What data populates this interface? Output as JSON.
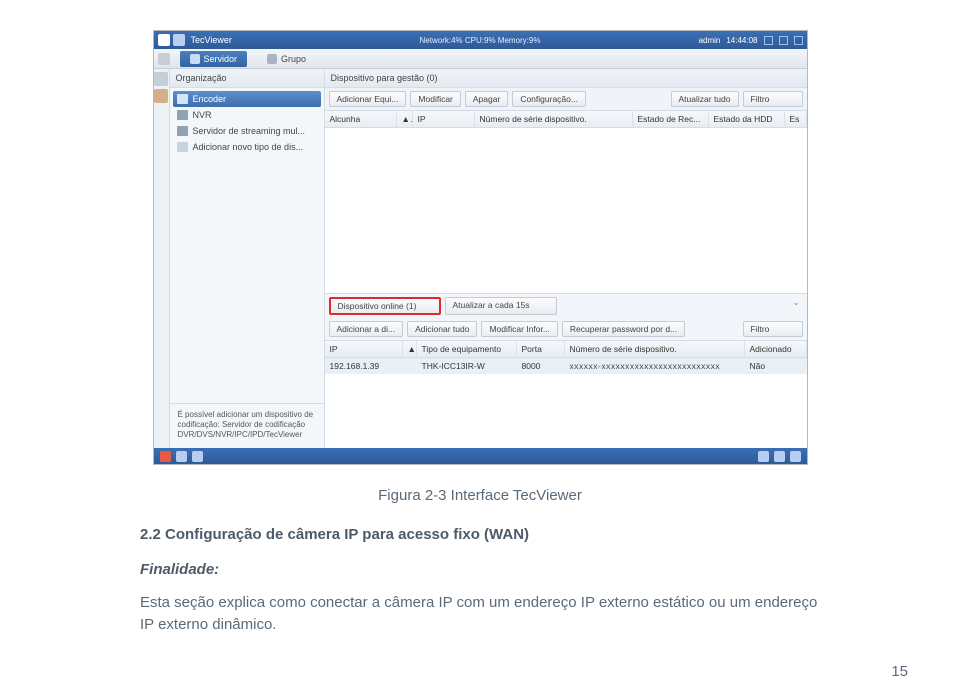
{
  "titlebar": {
    "app_name": "TecViewer",
    "network_status": "Network:4% CPU:9% Memory:9%",
    "user": "admin",
    "time": "14:44:08"
  },
  "topbar": {
    "tab_server": "Servidor",
    "tab_group": "Grupo"
  },
  "sidebar": {
    "title": "Organização",
    "items": [
      {
        "label": "Encoder"
      },
      {
        "label": "NVR"
      },
      {
        "label": "Servidor de streaming mul..."
      },
      {
        "label": "Adicionar novo tipo de dis..."
      }
    ],
    "note": "É possível adicionar um dispositivo de codificação: Servidor de codificação DVR/DVS/NVR/IPC/IPD/TecViewer"
  },
  "upper": {
    "title": "Dispositivo para gestão (0)",
    "buttons": {
      "add": "Adicionar Equi...",
      "modify": "Modificar",
      "delete": "Apagar",
      "config": "Configuração...",
      "refresh": "Atualizar tudo",
      "filter": "Filtro"
    },
    "columns": {
      "alias": "Alcunha",
      "sort": "▲",
      "ip": "IP",
      "serial": "Número de série dispositivo.",
      "recstate": "Estado de Rec...",
      "hdd": "Estado da HDD",
      "es": "Es"
    }
  },
  "lower": {
    "tabs": {
      "online": "Dispositivo online (1)",
      "refresh15": "Atualizar a cada 15s"
    },
    "buttons": {
      "add_dev": "Adicionar a di...",
      "add_all": "Adicionar tudo",
      "mod_info": "Modificar Infor...",
      "recover_pw": "Recuperar password por d...",
      "filter": "Filtro"
    },
    "columns": {
      "ip": "IP",
      "sort": "▲",
      "type": "Tipo de equipamento",
      "port": "Porta",
      "serial": "Número de série dispositivo.",
      "added": "Adicionado"
    },
    "row": {
      "ip": "192.168.1.39",
      "type": "THK-ICC13IR-W",
      "port": "8000",
      "serial": "xxxxxx-xxxxxxxxxxxxxxxxxxxxxxxxx",
      "added": "Não"
    }
  },
  "doc": {
    "caption": "Figura 2-3 Interface TecViewer",
    "heading": "2.2 Configuração de câmera IP para acesso fixo (WAN)",
    "subheading": "Finalidade:",
    "body": "Esta seção explica como conectar a câmera IP com um endereço IP externo estático ou um endereço IP externo dinâmico.",
    "pagenum": "15"
  }
}
